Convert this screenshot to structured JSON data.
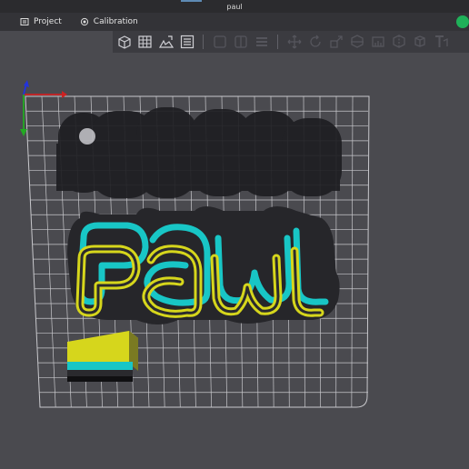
{
  "window": {
    "title": "paul"
  },
  "menu": {
    "items": [
      {
        "label": "Project",
        "icon": "project-icon"
      },
      {
        "label": "Calibration",
        "icon": "calibration-icon"
      }
    ]
  },
  "toolbar": {
    "tools": [
      "add-object-icon",
      "arrange-grid-icon",
      "auto-orient-icon",
      "plate-settings-icon",
      "split-objects-icon",
      "split-parts-icon",
      "layers-icon",
      "move-icon",
      "rotate-icon",
      "scale-icon",
      "cut-icon",
      "support-paint-icon",
      "seam-paint-icon",
      "measure-icon",
      "text-icon"
    ]
  },
  "scene": {
    "model_text": "PAUL",
    "colors": {
      "background": "#4a4a4f",
      "grid": "#c8c8cc",
      "shadow": "#1e1e22",
      "yellow": "#d6d61c",
      "cyan": "#18c6c6",
      "dark": "#2a2a2e"
    },
    "axes": {
      "x_color": "#cc2222",
      "y_color": "#22aa22",
      "z_color": "#2233dd"
    }
  },
  "status": {
    "toggle_color": "#1fb159"
  }
}
